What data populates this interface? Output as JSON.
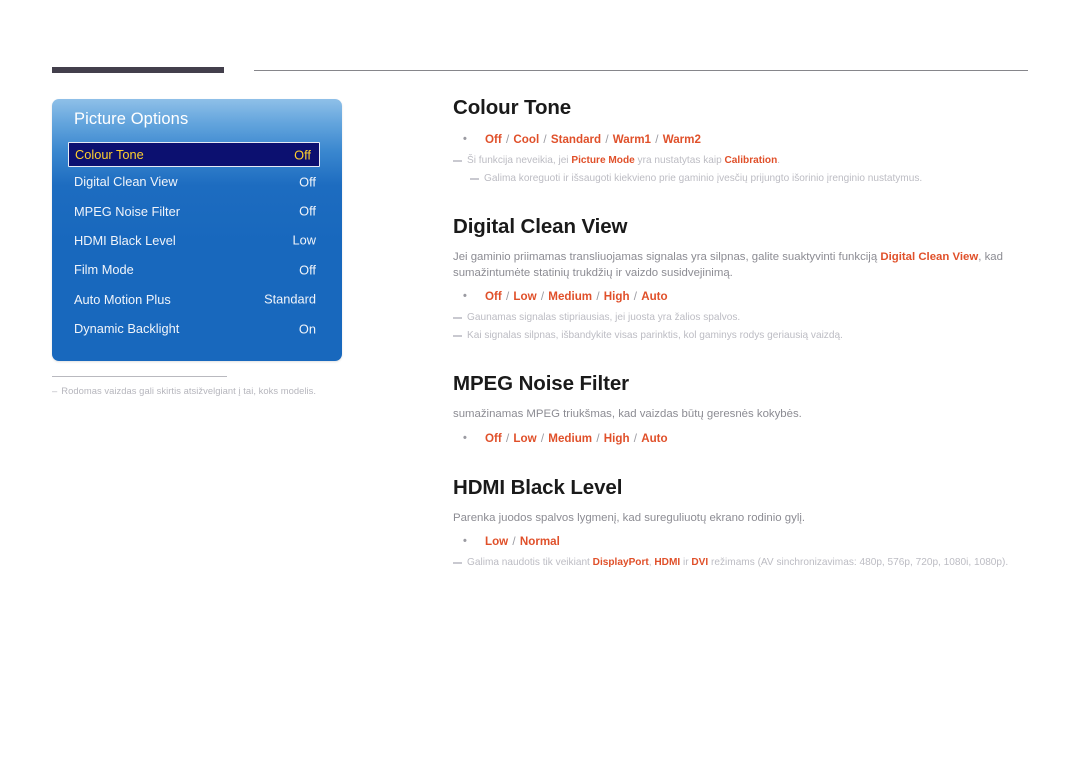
{
  "page": {
    "language": "lt",
    "accent_color": "#e0502a",
    "osd_panel_blue": "#1868bd",
    "osd_selected_bg": "#0c1070",
    "osd_selected_text": "#ffcf2e",
    "rule_dark_color": "#433f4c"
  },
  "osd": {
    "title": "Picture Options",
    "rows": [
      {
        "label": "Colour Tone",
        "value": "Off",
        "selected": true
      },
      {
        "label": "Digital Clean View",
        "value": "Off",
        "selected": false
      },
      {
        "label": "MPEG Noise Filter",
        "value": "Off",
        "selected": false
      },
      {
        "label": "HDMI Black Level",
        "value": "Low",
        "selected": false
      },
      {
        "label": "Film Mode",
        "value": "Off",
        "selected": false
      },
      {
        "label": "Auto Motion Plus",
        "value": "Standard",
        "selected": false
      },
      {
        "label": "Dynamic Backlight",
        "value": "On",
        "selected": false
      }
    ]
  },
  "left_note": {
    "dash": "–",
    "text": "Rodomas vaizdas gali skirtis atsižvelgiant į tai, koks modelis."
  },
  "sections": {
    "colour_tone": {
      "title": "Colour Tone",
      "options": [
        {
          "name": "Off",
          "sep": " / "
        },
        {
          "name": "Cool",
          "sep": " / "
        },
        {
          "name": "Standard",
          "sep": " / "
        },
        {
          "name": "Warm1",
          "sep": " / "
        },
        {
          "name": "Warm2",
          "sep": ""
        }
      ],
      "notes": [
        {
          "parts": [
            {
              "t": "Ši funkcija neveikia, jei ",
              "hl": false
            },
            {
              "t": "Picture Mode",
              "hl": true
            },
            {
              "t": " yra nustatytas kaip ",
              "hl": false
            },
            {
              "t": "Calibration",
              "hl": true
            },
            {
              "t": ".",
              "hl": false
            }
          ],
          "indent": false
        },
        {
          "parts": [
            {
              "t": "Galima koreguoti ir išsaugoti kiekvieno prie gaminio įvesčių prijungto išorinio įrenginio nustatymus.",
              "hl": false
            }
          ],
          "indent": true
        }
      ]
    },
    "digital_clean_view": {
      "title": "Digital Clean View",
      "paragraph": [
        {
          "t": "Jei gaminio priimamas transliuojamas signalas yra silpnas, galite suaktyvinti funkciją ",
          "hl": false
        },
        {
          "t": "Digital Clean View",
          "hl": true
        },
        {
          "t": ", kad sumažintumėte statinių trukdžių ir vaizdo susidvejinimą.",
          "hl": false
        }
      ],
      "options": [
        {
          "name": "Off",
          "sep": " / "
        },
        {
          "name": "Low",
          "sep": " / "
        },
        {
          "name": "Medium",
          "sep": " / "
        },
        {
          "name": "High",
          "sep": " / "
        },
        {
          "name": "Auto",
          "sep": ""
        }
      ],
      "notes": [
        {
          "parts": [
            {
              "t": "Gaunamas signalas stipriausias, jei juosta yra žalios spalvos.",
              "hl": false
            }
          ],
          "indent": false
        },
        {
          "parts": [
            {
              "t": "Kai signalas silpnas, išbandykite visas parinktis, kol gaminys rodys geriausią vaizdą.",
              "hl": false
            }
          ],
          "indent": false
        }
      ]
    },
    "mpeg_noise_filter": {
      "title": "MPEG Noise Filter",
      "paragraph": [
        {
          "t": "sumažinamas MPEG triukšmas, kad vaizdas būtų geresnės kokybės.",
          "hl": false
        }
      ],
      "options": [
        {
          "name": "Off",
          "sep": " / "
        },
        {
          "name": "Low",
          "sep": " / "
        },
        {
          "name": "Medium",
          "sep": " / "
        },
        {
          "name": "High",
          "sep": " / "
        },
        {
          "name": "Auto",
          "sep": ""
        }
      ],
      "notes": []
    },
    "hdmi_black_level": {
      "title": "HDMI Black Level",
      "paragraph": [
        {
          "t": "Parenka juodos spalvos lygmenį, kad sureguliuotų ekrano rodinio gylį.",
          "hl": false
        }
      ],
      "options": [
        {
          "name": "Low",
          "sep": " / "
        },
        {
          "name": "Normal",
          "sep": ""
        }
      ],
      "notes": [
        {
          "parts": [
            {
              "t": "Galima naudotis tik veikiant ",
              "hl": false
            },
            {
              "t": "DisplayPort",
              "hl": true
            },
            {
              "t": ", ",
              "hl": false
            },
            {
              "t": "HDMI",
              "hl": true
            },
            {
              "t": " ir ",
              "hl": false
            },
            {
              "t": "DVI",
              "hl": true
            },
            {
              "t": " režimams (AV sinchronizavimas: 480p, 576p, 720p, 1080i, 1080p).",
              "hl": false
            }
          ],
          "indent": false
        }
      ]
    }
  }
}
